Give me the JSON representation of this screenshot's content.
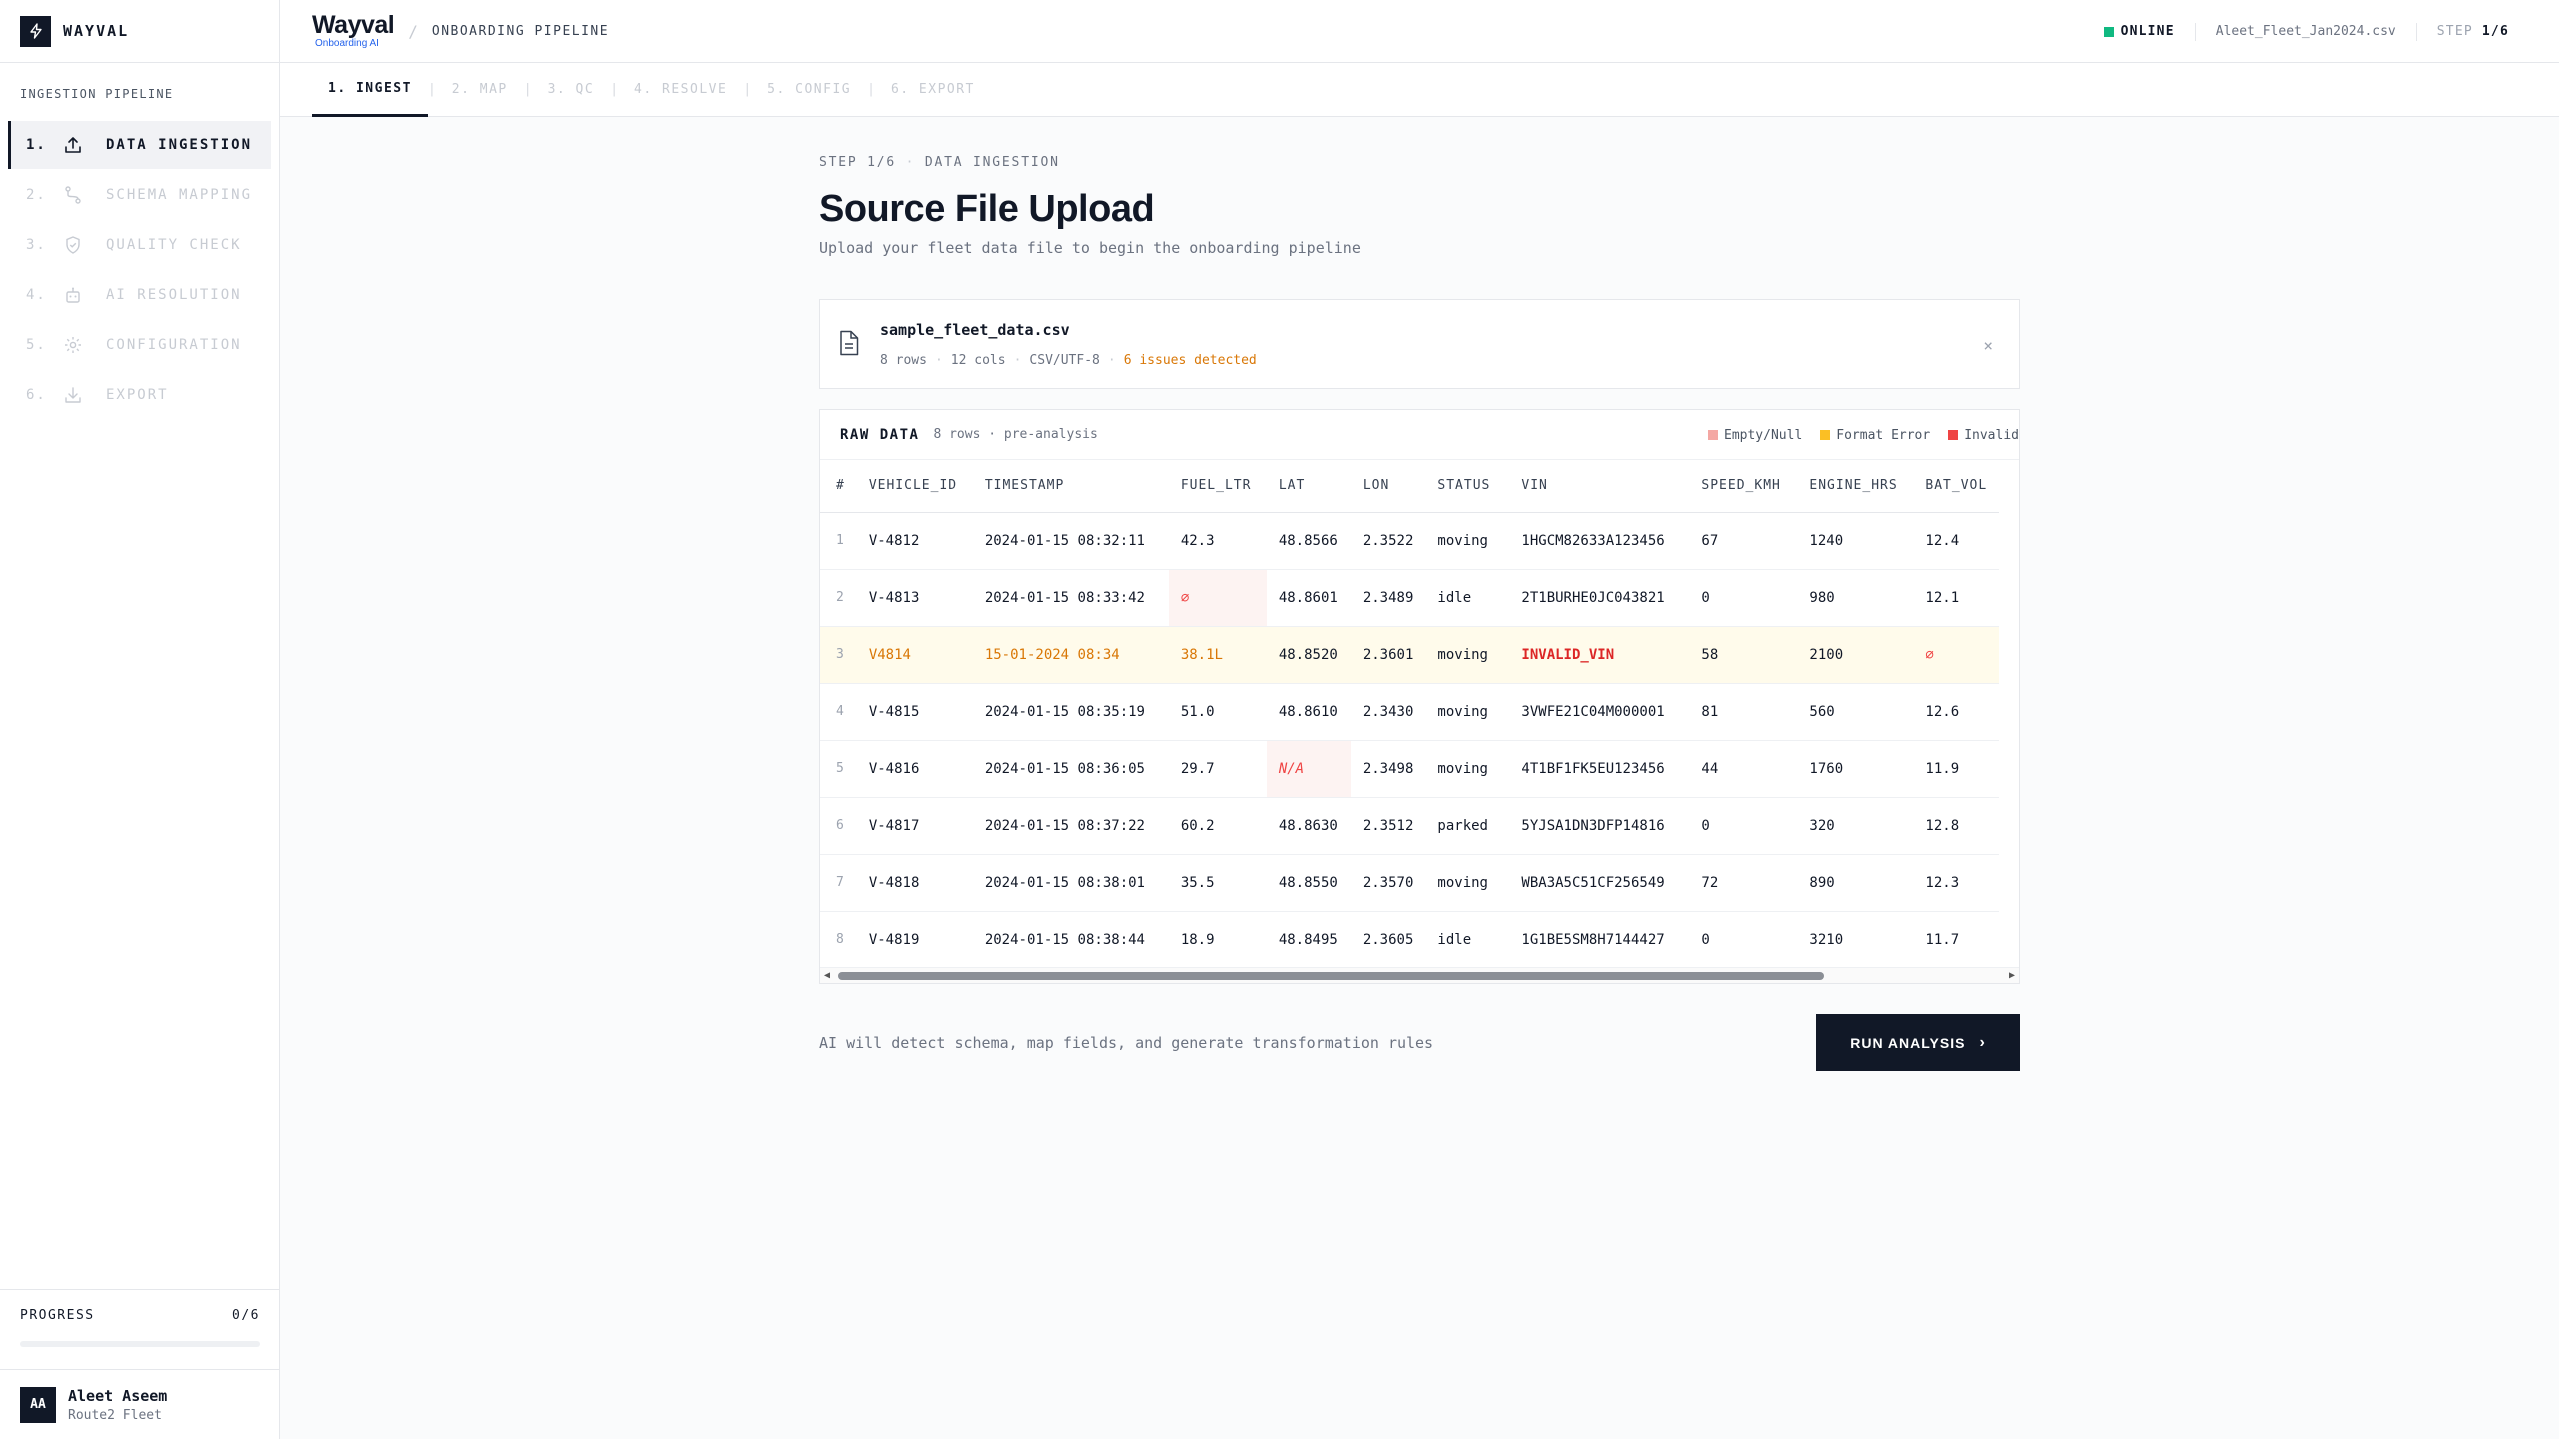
{
  "sidebar": {
    "brand": "WAYVAL",
    "section_title": "INGESTION PIPELINE",
    "items": [
      {
        "num": "1.",
        "label": "DATA INGESTION",
        "icon": "upload-icon"
      },
      {
        "num": "2.",
        "label": "SCHEMA MAPPING",
        "icon": "route-icon"
      },
      {
        "num": "3.",
        "label": "QUALITY CHECK",
        "icon": "shield-check-icon"
      },
      {
        "num": "4.",
        "label": "AI RESOLUTION",
        "icon": "robot-icon"
      },
      {
        "num": "5.",
        "label": "CONFIGURATION",
        "icon": "gear-icon"
      },
      {
        "num": "6.",
        "label": "EXPORT",
        "icon": "download-icon"
      }
    ],
    "progress": {
      "label": "PROGRESS",
      "value": "0/6",
      "fraction": 0
    },
    "user": {
      "initials": "AA",
      "name": "Aleet Aseem",
      "org": "Route2 Fleet"
    }
  },
  "header": {
    "logo_word": "Wayval",
    "logo_sub": "Onboarding AI",
    "breadcrumb": "ONBOARDING PIPELINE",
    "status": "ONLINE",
    "status_color": "#10b981",
    "file": "Aleet_Fleet_Jan2024.csv",
    "step_prefix": "STEP",
    "step_value": "1/6"
  },
  "tabs": [
    {
      "label": "1. INGEST"
    },
    {
      "label": "2. MAP"
    },
    {
      "label": "3. QC"
    },
    {
      "label": "4. RESOLVE"
    },
    {
      "label": "5. CONFIG"
    },
    {
      "label": "6. EXPORT"
    }
  ],
  "main": {
    "eyebrow_step": "STEP 1/6",
    "eyebrow_name": "DATA INGESTION",
    "title": "Source File Upload",
    "subtitle": "Upload your fleet data file to begin the onboarding pipeline",
    "file_card": {
      "name": "sample_fleet_data.csv",
      "rows": "8 rows",
      "cols": "12 cols",
      "encoding": "CSV/UTF-8",
      "issues": "6 issues detected",
      "close": "×"
    },
    "raw_data": {
      "title": "RAW DATA",
      "subtitle": "8 rows · pre-analysis",
      "legend": [
        {
          "label": "Empty/Null",
          "color": "#f4a7a3"
        },
        {
          "label": "Format Error",
          "color": "#fbbf24"
        },
        {
          "label": "Invalid",
          "color": "#ef4444"
        }
      ],
      "columns": [
        "#",
        "VEHICLE_ID",
        "TIMESTAMP",
        "FUEL_LTR",
        "LAT",
        "LON",
        "STATUS",
        "VIN",
        "SPEED_KMH",
        "ENGINE_HRS",
        "BAT_VOL"
      ],
      "rows": [
        [
          "1",
          "V-4812",
          "2024-01-15 08:32:11",
          "42.3",
          "48.8566",
          "2.3522",
          "moving",
          "1HGCM82633A123456",
          "67",
          "1240",
          "12.4"
        ],
        [
          "2",
          "V-4813",
          "2024-01-15 08:33:42",
          "∅",
          "48.8601",
          "2.3489",
          "idle",
          "2T1BURHE0JC043821",
          "0",
          "980",
          "12.1"
        ],
        [
          "3",
          "V4814",
          "15-01-2024 08:34",
          "38.1L",
          "48.8520",
          "2.3601",
          "moving",
          "INVALID_VIN",
          "58",
          "2100",
          "∅"
        ],
        [
          "4",
          "V-4815",
          "2024-01-15 08:35:19",
          "51.0",
          "48.8610",
          "2.3430",
          "moving",
          "3VWFE21C04M000001",
          "81",
          "560",
          "12.6"
        ],
        [
          "5",
          "V-4816",
          "2024-01-15 08:36:05",
          "29.7",
          "N/A",
          "2.3498",
          "moving",
          "4T1BF1FK5EU123456",
          "44",
          "1760",
          "11.9"
        ],
        [
          "6",
          "V-4817",
          "2024-01-15 08:37:22",
          "60.2",
          "48.8630",
          "2.3512",
          "parked",
          "5YJSA1DN3DFP14816",
          "0",
          "320",
          "12.8"
        ],
        [
          "7",
          "V-4818",
          "2024-01-15 08:38:01",
          "35.5",
          "48.8550",
          "2.3570",
          "moving",
          "WBA3A5C51CF256549",
          "72",
          "890",
          "12.3"
        ],
        [
          "8",
          "V-4819",
          "2024-01-15 08:38:44",
          "18.9",
          "48.8495",
          "2.3605",
          "idle",
          "1G1BE5SM8H7144427",
          "0",
          "3210",
          "11.7"
        ]
      ],
      "cell_flags": {
        "1-3": "empty",
        "2-1": "format",
        "2-2": "format",
        "2-3": "format",
        "2-7": "invalid",
        "2-10": "empty",
        "4-4": "empty"
      }
    },
    "footer_note": "AI will detect schema, map fields, and generate transformation rules",
    "run_button": "RUN ANALYSIS"
  }
}
